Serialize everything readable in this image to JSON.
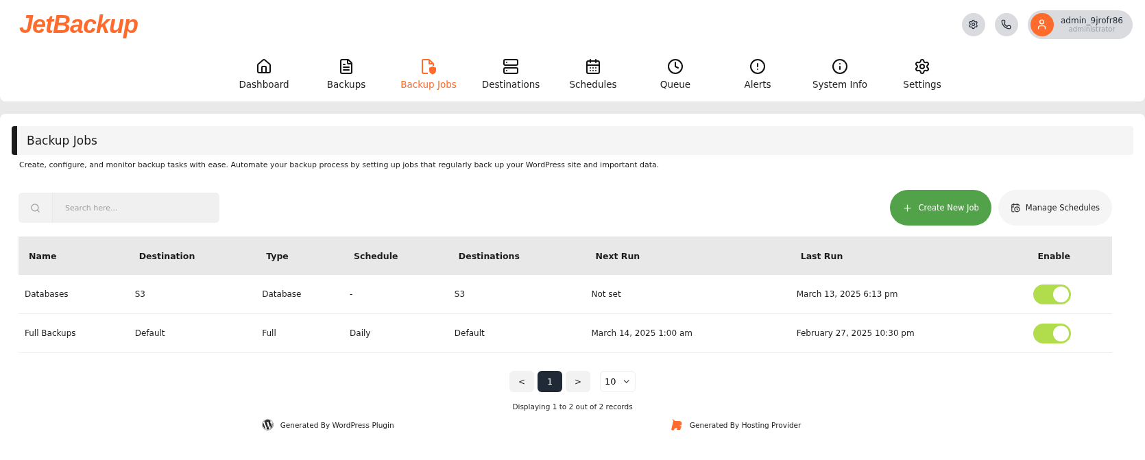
{
  "header": {
    "logo": "JetBackup",
    "user": {
      "name": "admin_9jrofr86",
      "role": "administrator"
    }
  },
  "nav": [
    {
      "label": "Dashboard",
      "selected": false
    },
    {
      "label": "Backups",
      "selected": false
    },
    {
      "label": "Backup Jobs",
      "selected": true
    },
    {
      "label": "Destinations",
      "selected": false
    },
    {
      "label": "Schedules",
      "selected": false
    },
    {
      "label": "Queue",
      "selected": false
    },
    {
      "label": "Alerts",
      "selected": false
    },
    {
      "label": "System Info",
      "selected": false
    },
    {
      "label": "Settings",
      "selected": false
    }
  ],
  "page": {
    "title": "Backup Jobs",
    "description": "Create, configure, and monitor backup tasks with ease. Automate your backup process by setting up jobs that regularly back up your WordPress site and important data."
  },
  "search": {
    "placeholder": "Search here..."
  },
  "actions": [
    {
      "label": "Create New Job",
      "kind": "primary"
    },
    {
      "label": "Manage Schedules",
      "kind": "secondary"
    }
  ],
  "table": {
    "columns": [
      "Name",
      "Destination",
      "Type",
      "Schedule",
      "Destinations",
      "Next Run",
      "Last Run",
      "Enable"
    ],
    "rows": [
      {
        "cells": [
          "Databases",
          "S3",
          "Database",
          "-",
          "S3",
          "Not set",
          "March 13, 2025 6:13 pm"
        ],
        "enabled": true
      },
      {
        "cells": [
          "Full Backups",
          "Default",
          "Full",
          "Daily",
          "Default",
          "March 14, 2025 1:00 am",
          "February 27, 2025 10:30 pm"
        ],
        "enabled": true
      }
    ]
  },
  "pagination": {
    "prev": "<",
    "pages": [
      {
        "label": "1",
        "selected": true
      }
    ],
    "next": ">",
    "per_page": "10",
    "summary": "Displaying 1 to 2 out of 2 records"
  },
  "footer": [
    {
      "kind": "wordpress",
      "text": "Generated By WordPress Plugin"
    },
    {
      "kind": "hosting",
      "text": "Generated By Hosting Provider"
    }
  ]
}
